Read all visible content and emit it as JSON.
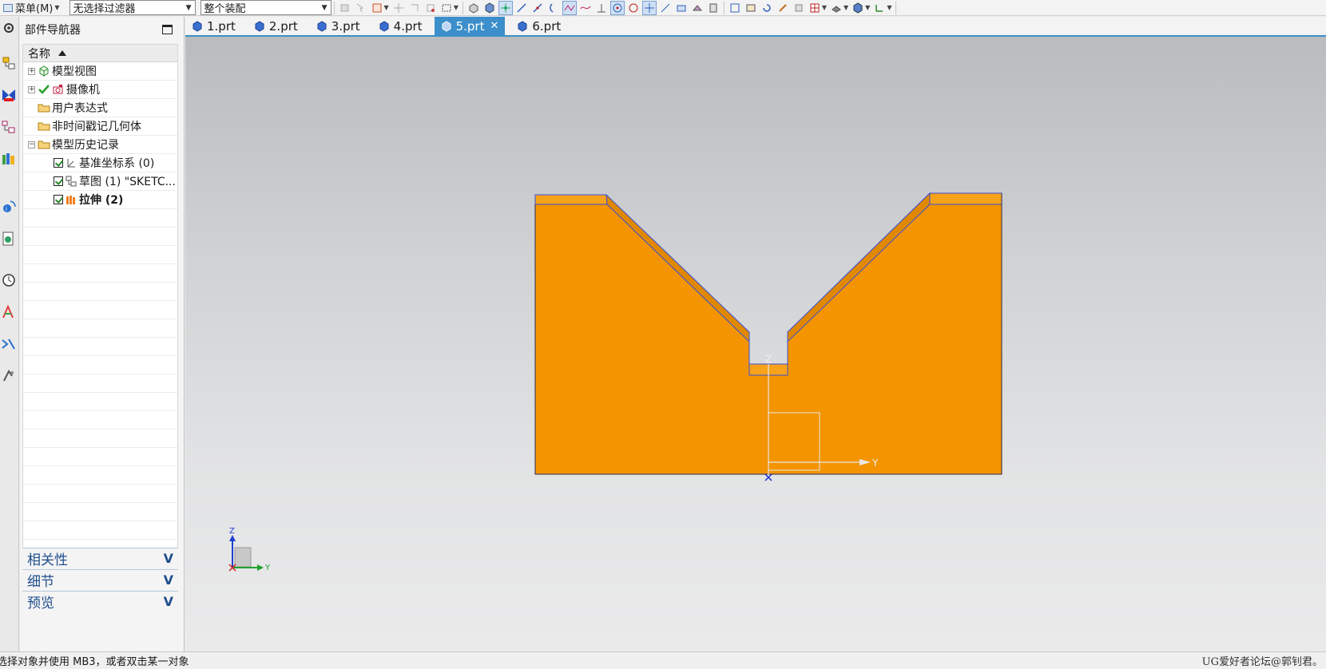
{
  "toolbar": {
    "menu_label": "菜单(M)",
    "selection_filter": "无选择过滤器",
    "assembly_scope": "整个装配"
  },
  "navigator": {
    "title": "部件导航器",
    "column_name": "名称",
    "items": [
      {
        "label": "模型视图",
        "icon": "model-views-icon"
      },
      {
        "label": "摄像机",
        "icon": "camera-icon"
      },
      {
        "label": "用户表达式",
        "icon": "folder-icon"
      },
      {
        "label": "非时间戳记几何体",
        "icon": "folder-icon"
      },
      {
        "label": "模型历史记录",
        "icon": "folder-icon"
      },
      {
        "label": "基准坐标系 (0)",
        "icon": "datum-csys-icon"
      },
      {
        "label": "草图 (1) \"SKETC...",
        "icon": "sketch-icon"
      },
      {
        "label": "拉伸 (2)",
        "icon": "extrude-icon"
      }
    ],
    "panels": [
      {
        "label": "相关性"
      },
      {
        "label": "细节"
      },
      {
        "label": "预览"
      }
    ]
  },
  "tabs": [
    {
      "label": "1.prt",
      "active": false
    },
    {
      "label": "2.prt",
      "active": false
    },
    {
      "label": "3.prt",
      "active": false
    },
    {
      "label": "4.prt",
      "active": false
    },
    {
      "label": "5.prt",
      "active": true
    },
    {
      "label": "6.prt",
      "active": false
    }
  ],
  "viewport": {
    "axis_z": "Z",
    "axis_y": "Y",
    "triad_z": "Z",
    "triad_y": "Y",
    "model_color": "#f39400",
    "edge_color": "#3a4fd6"
  },
  "status": {
    "message": "选择对象并使用 MB3，或者双击某一对象",
    "watermark": "UG爱好者论坛@郭钊君。"
  }
}
